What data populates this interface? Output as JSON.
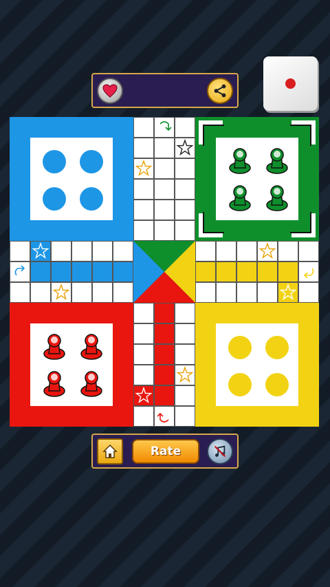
{
  "header": {
    "like_icon": "heart-icon",
    "share_icon": "share-icon"
  },
  "dice": {
    "face": 1,
    "pip_color": "#d81e1e"
  },
  "board": {
    "colors": {
      "blue": "#1e96e6",
      "green": "#0f8f2c",
      "red": "#e8160f",
      "yellow": "#f2d314"
    },
    "homes": [
      {
        "color": "blue",
        "pawns_at_home": 4,
        "state": "empty-slots"
      },
      {
        "color": "green",
        "pawns_at_home": 4,
        "state": "pawns",
        "highlighted": true
      },
      {
        "color": "red",
        "pawns_at_home": 4,
        "state": "pawns"
      },
      {
        "color": "yellow",
        "pawns_at_home": 4,
        "state": "empty-slots"
      }
    ]
  },
  "footer": {
    "rate_label": "Rate",
    "home_icon": "home-icon",
    "music_icon": "music-off-icon"
  }
}
